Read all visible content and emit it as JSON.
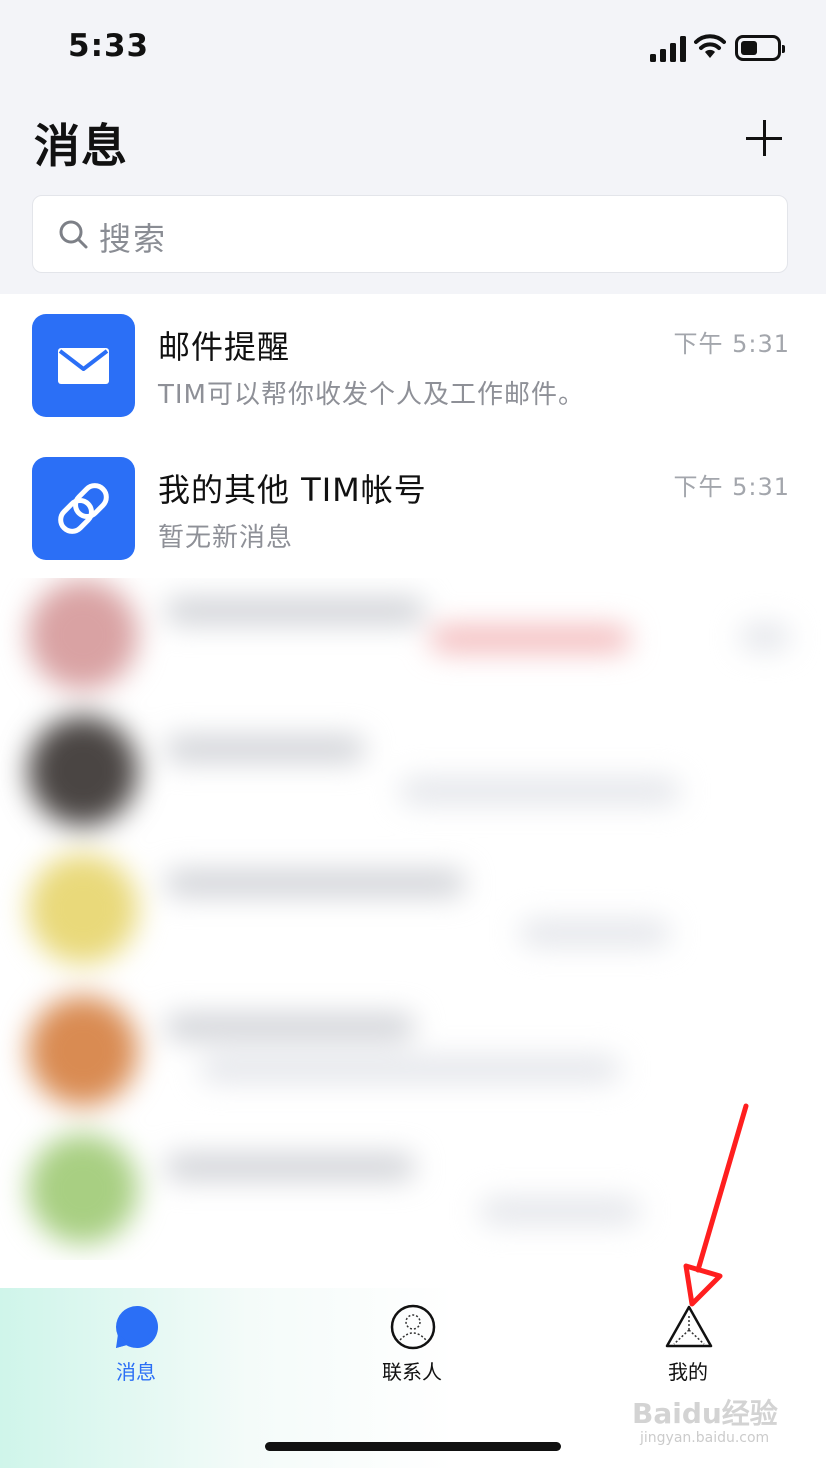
{
  "status_bar": {
    "time": "5:33"
  },
  "header": {
    "title": "消息",
    "search_placeholder": "搜索"
  },
  "messages": [
    {
      "title": "邮件提醒",
      "subtitle": "TIM可以帮你收发个人及工作邮件。",
      "time": "下午 5:31",
      "icon": "mail-icon"
    },
    {
      "title": "我的其他 TIM帐号",
      "subtitle": "暂无新消息",
      "time": "下午 5:31",
      "icon": "link-icon"
    }
  ],
  "tabs": [
    {
      "label": "消息",
      "icon": "chat-bubble-icon",
      "active": true
    },
    {
      "label": "联系人",
      "icon": "contacts-icon",
      "active": false
    },
    {
      "label": "我的",
      "icon": "profile-triangle-icon",
      "active": false
    }
  ],
  "colors": {
    "accent": "#2b6ff6",
    "header_bg": "#f3f4f8",
    "annotation_arrow": "#ff1f1f"
  },
  "watermark": {
    "brand": "Baidu经验",
    "url": "jingyan.baidu.com"
  }
}
